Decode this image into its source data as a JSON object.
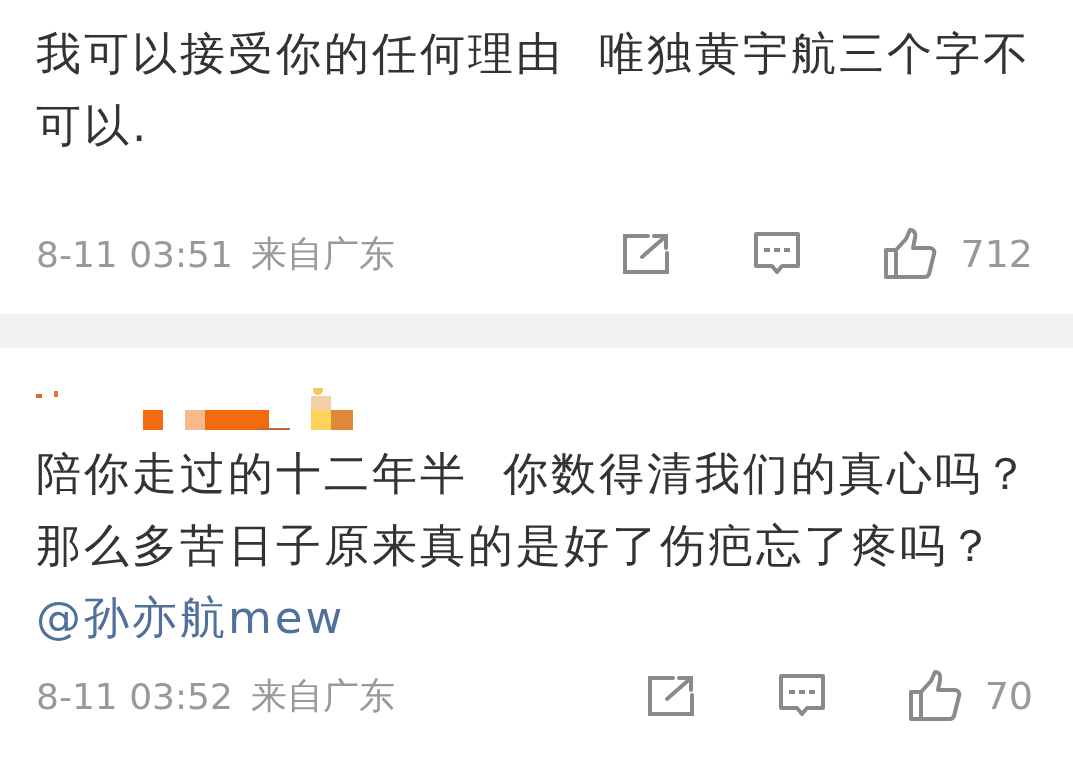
{
  "comments": [
    {
      "text": "我可以接受你的任何理由  唯独黄宇航三个字不可以.",
      "time": "8-11 03:51",
      "location": "来自广东",
      "likes": "712",
      "show_author": false
    },
    {
      "text": "陪你走过的十二年半  你数得清我们的真心吗？那么多苦日子原来真的是好了伤疤忘了疼吗？",
      "mention": "@孙亦航mew",
      "time": "8-11 03:52",
      "location": "来自广东",
      "likes": "70",
      "show_author": true
    }
  ]
}
